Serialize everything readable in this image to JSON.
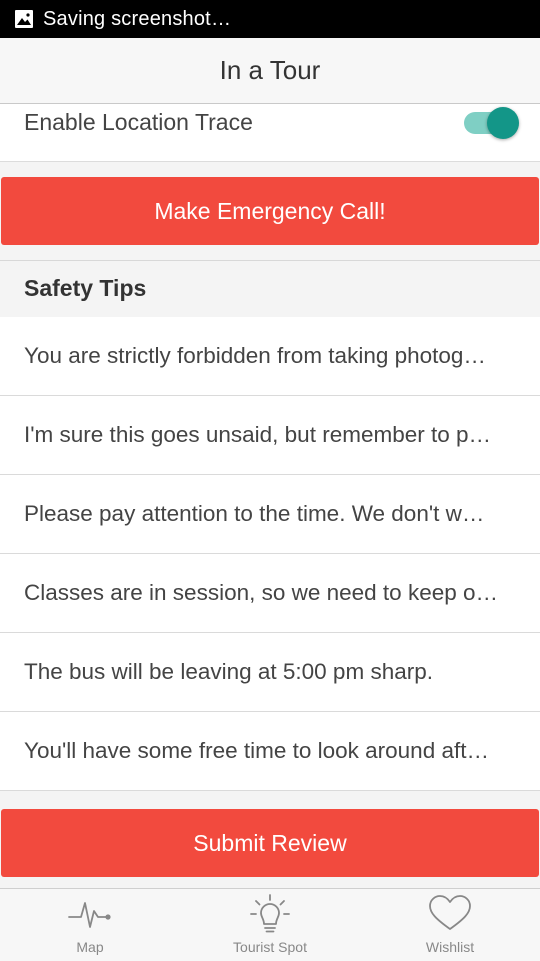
{
  "status_bar": {
    "text": "Saving screenshot…",
    "icon": "image-icon"
  },
  "header": {
    "title": "In a Tour"
  },
  "location": {
    "label": "Enable Location Trace",
    "toggle_on": true
  },
  "emergency_button": {
    "label": "Make Emergency Call!"
  },
  "safety_tips": {
    "title": "Safety Tips",
    "items": [
      "You are strictly forbidden from taking photog…",
      "I'm sure this goes unsaid, but remember to p…",
      "Please pay attention to the time. We don't w…",
      "Classes are in session, so we need to keep o…",
      "The bus will be leaving at 5:00 pm sharp.",
      "You'll have some free time to look around aft…"
    ]
  },
  "submit_button": {
    "label": "Submit Review"
  },
  "tabs": [
    {
      "label": "Map",
      "icon": "pulse-icon"
    },
    {
      "label": "Tourist Spot",
      "icon": "lightbulb-icon"
    },
    {
      "label": "Wishlist",
      "icon": "heart-icon"
    }
  ],
  "colors": {
    "accent_red": "#f24a3e",
    "toggle_teal": "#139688"
  }
}
